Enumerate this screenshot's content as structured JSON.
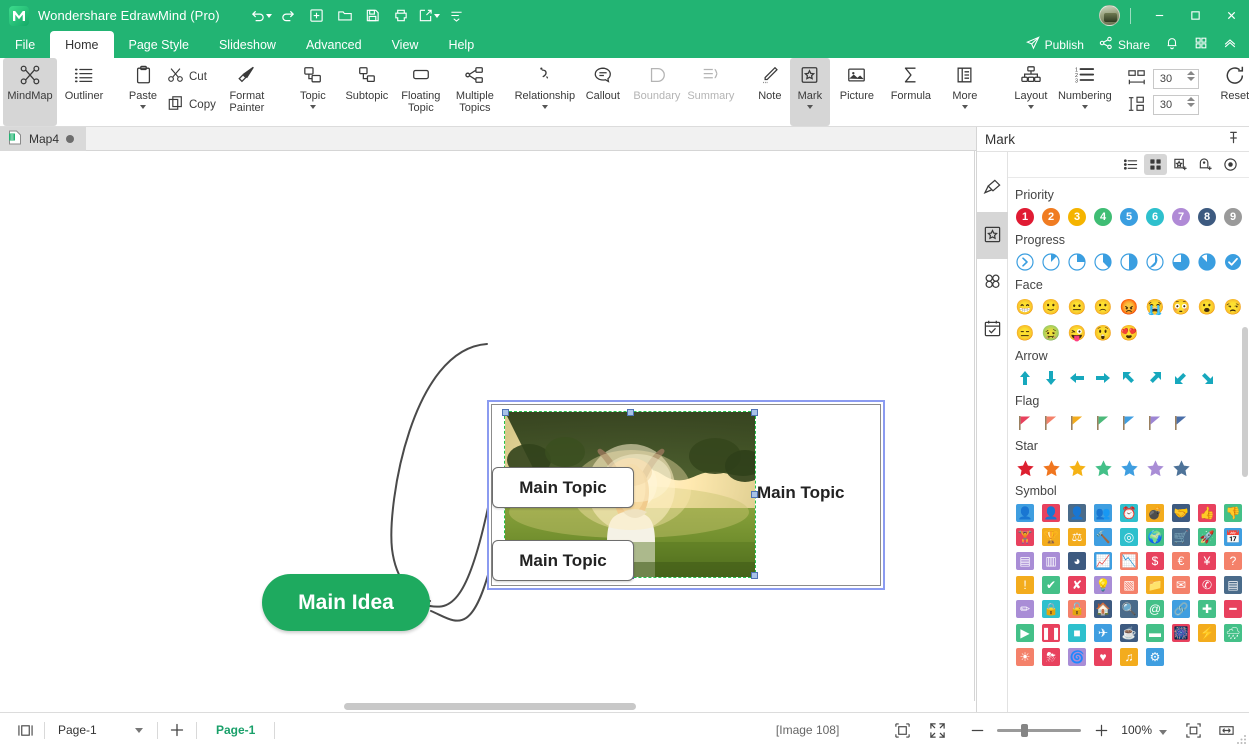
{
  "titlebar": {
    "app_title": "Wondershare EdrawMind (Pro)",
    "quick_access": [
      {
        "name": "undo-button",
        "icon": "undo-icon",
        "has_dropdown": true
      },
      {
        "name": "redo-button",
        "icon": "redo-icon",
        "has_dropdown": false
      },
      {
        "name": "new-button",
        "icon": "plus-box-icon",
        "has_dropdown": false
      },
      {
        "name": "open-button",
        "icon": "folder-icon",
        "has_dropdown": false
      },
      {
        "name": "save-button",
        "icon": "floppy-icon",
        "has_dropdown": false
      },
      {
        "name": "print-button",
        "icon": "printer-icon",
        "has_dropdown": false
      },
      {
        "name": "export-button",
        "icon": "export-icon",
        "has_dropdown": true
      },
      {
        "name": "customize-qat-button",
        "icon": "overflow-icon",
        "has_dropdown": false
      }
    ],
    "window_controls": [
      "minimize",
      "maximize",
      "close"
    ]
  },
  "menubar": {
    "tabs": [
      {
        "label": "File",
        "active": false
      },
      {
        "label": "Home",
        "active": true
      },
      {
        "label": "Page Style",
        "active": false
      },
      {
        "label": "Slideshow",
        "active": false
      },
      {
        "label": "Advanced",
        "active": false
      },
      {
        "label": "View",
        "active": false
      },
      {
        "label": "Help",
        "active": false
      }
    ],
    "right_actions": [
      {
        "label": "Publish",
        "icon": "send-icon"
      },
      {
        "label": "Share",
        "icon": "share-nodes-icon"
      },
      {
        "label": "",
        "icon": "bell-icon"
      },
      {
        "label": "",
        "icon": "apps-grid-icon"
      },
      {
        "label": "",
        "icon": "collapse-ribbon-icon"
      }
    ]
  },
  "ribbon": {
    "groups": [
      {
        "items": [
          {
            "label": "MindMap",
            "icon": "mindmap-icon",
            "selected": true,
            "disabled": false,
            "dropdown": false
          },
          {
            "label": "Outliner",
            "icon": "outliner-icon",
            "selected": false,
            "disabled": false,
            "dropdown": false
          }
        ]
      },
      {
        "items": [
          {
            "label": "Paste",
            "icon": "paste-icon",
            "selected": false,
            "disabled": false,
            "dropdown": true
          },
          {
            "label": "Cut",
            "icon": "scissors-icon",
            "selected": false,
            "disabled": false,
            "dropdown": false
          },
          {
            "label": "Copy",
            "icon": "copy-icon",
            "selected": false,
            "disabled": false,
            "dropdown": false
          },
          {
            "label": "Format Painter",
            "icon": "format-painter-icon",
            "selected": false,
            "disabled": false,
            "dropdown": false
          }
        ]
      },
      {
        "items": [
          {
            "label": "Topic",
            "icon": "topic-icon",
            "selected": false,
            "disabled": false,
            "dropdown": true
          },
          {
            "label": "Subtopic",
            "icon": "subtopic-icon",
            "selected": false,
            "disabled": false,
            "dropdown": false
          },
          {
            "label": "Floating Topic",
            "icon": "floating-topic-icon",
            "selected": false,
            "disabled": false,
            "dropdown": false
          },
          {
            "label": "Multiple Topics",
            "icon": "multiple-topics-icon",
            "selected": false,
            "disabled": false,
            "dropdown": false
          }
        ]
      },
      {
        "items": [
          {
            "label": "Relationship",
            "icon": "relationship-icon",
            "selected": false,
            "disabled": false,
            "dropdown": true
          },
          {
            "label": "Callout",
            "icon": "callout-icon",
            "selected": false,
            "disabled": false,
            "dropdown": false
          },
          {
            "label": "Boundary",
            "icon": "boundary-icon",
            "selected": false,
            "disabled": true,
            "dropdown": false
          },
          {
            "label": "Summary",
            "icon": "summary-icon",
            "selected": false,
            "disabled": true,
            "dropdown": false
          }
        ]
      },
      {
        "items": [
          {
            "label": "Note",
            "icon": "note-icon",
            "selected": false,
            "disabled": false,
            "dropdown": false
          },
          {
            "label": "Mark",
            "icon": "mark-icon",
            "selected": true,
            "disabled": false,
            "dropdown": true
          },
          {
            "label": "Picture",
            "icon": "picture-icon",
            "selected": false,
            "disabled": false,
            "dropdown": false
          },
          {
            "label": "Formula",
            "icon": "formula-icon",
            "selected": false,
            "disabled": false,
            "dropdown": false
          },
          {
            "label": "More",
            "icon": "more-icon",
            "selected": false,
            "disabled": false,
            "dropdown": true
          }
        ]
      },
      {
        "items": [
          {
            "label": "Layout",
            "icon": "layout-icon",
            "selected": false,
            "disabled": false,
            "dropdown": true
          },
          {
            "label": "Numbering",
            "icon": "numbering-icon",
            "selected": false,
            "disabled": false,
            "dropdown": true
          }
        ]
      },
      {
        "items": [
          {
            "label": "Reset",
            "icon": "reset-icon",
            "selected": false,
            "disabled": false,
            "dropdown": false
          }
        ]
      }
    ],
    "spacing": {
      "horizontal_icon": "horizontal-spacing-icon",
      "horizontal_value": "30",
      "vertical_icon": "vertical-spacing-icon",
      "vertical_value": "30"
    }
  },
  "doctab": {
    "label": "Map4",
    "icon": "document-icon",
    "modified_dot": true
  },
  "canvas": {
    "central_topic": "Main Idea",
    "topics": [
      {
        "label": "Main Topic",
        "selected": true,
        "has_image": true
      },
      {
        "label": "Main Topic",
        "selected": false,
        "has_image": false
      },
      {
        "label": "Main Topic",
        "selected": false,
        "has_image": false
      }
    ],
    "image_alt": "woman raising arms in sunlit field"
  },
  "panel": {
    "title": "Mark",
    "pin_icon": "pin-icon",
    "side_tabs": [
      {
        "name": "style-tab",
        "icon": "brush-icon",
        "selected": false
      },
      {
        "name": "mark-tab",
        "icon": "mark-badge-icon",
        "selected": true
      },
      {
        "name": "clipart-tab",
        "icon": "clover-icon",
        "selected": false
      },
      {
        "name": "task-tab",
        "icon": "task-calendar-icon",
        "selected": false
      }
    ],
    "tools": [
      {
        "name": "list-view-button",
        "icon": "list-view-icon",
        "selected": false
      },
      {
        "name": "grid-view-button",
        "icon": "grid-view-icon",
        "selected": true
      },
      {
        "name": "add-mark-button",
        "icon": "add-mark-icon",
        "selected": false
      },
      {
        "name": "add-custom-mark-button",
        "icon": "add-custom-mark-icon",
        "selected": false
      },
      {
        "name": "preview-button",
        "icon": "eye-icon",
        "selected": false
      }
    ],
    "sections": [
      {
        "title": "Priority",
        "type": "priority",
        "items": [
          {
            "label": "1",
            "color": "#e01b33"
          },
          {
            "label": "2",
            "color": "#f07c22"
          },
          {
            "label": "3",
            "color": "#f5b400"
          },
          {
            "label": "4",
            "color": "#3fbd74"
          },
          {
            "label": "5",
            "color": "#3a9ee0"
          },
          {
            "label": "6",
            "color": "#2ec0cd"
          },
          {
            "label": "7",
            "color": "#b08ad6"
          },
          {
            "label": "8",
            "color": "#3d5a80"
          },
          {
            "label": "9",
            "color": "#9a9a9a"
          }
        ]
      },
      {
        "title": "Progress",
        "type": "progress",
        "color": "#3a9ee0",
        "items": [
          0,
          12.5,
          25,
          37.5,
          50,
          62.5,
          75,
          87.5,
          100
        ]
      },
      {
        "title": "Face",
        "type": "face",
        "items": [
          "😁",
          "🙂",
          "😐",
          "🙁",
          "😡",
          "😭",
          "😳",
          "😮",
          "😒",
          "😑",
          "🤢",
          "😜",
          "😲",
          "😍"
        ]
      },
      {
        "title": "Arrow",
        "type": "arrow",
        "color": "#17a8bd",
        "items": [
          "up",
          "down",
          "left",
          "right",
          "up-left",
          "up-right",
          "down-left",
          "down-right"
        ]
      },
      {
        "title": "Flag",
        "type": "flag",
        "items": [
          "#e8415e",
          "#f4816a",
          "#f3ac1d",
          "#4cb97a",
          "#3f9ee0",
          "#9d86d4",
          "#4a6ea8"
        ]
      },
      {
        "title": "Star",
        "type": "star",
        "items": [
          "#dd2030",
          "#f0761f",
          "#f5b215",
          "#44c088",
          "#3f9ee0",
          "#a98dd6",
          "#4e7399"
        ]
      },
      {
        "title": "Symbol",
        "type": "symbol",
        "rows": [
          [
            {
              "name": "user-icon",
              "bg": "#3f9ee0",
              "glyph": "👤"
            },
            {
              "name": "user-alt-icon",
              "bg": "#e8415e",
              "glyph": "👤"
            },
            {
              "name": "user-dark-icon",
              "bg": "#4a6b8a",
              "glyph": "👤"
            },
            {
              "name": "users-icon",
              "bg": "#3f9ee0",
              "glyph": "👥"
            },
            {
              "name": "alarm-clock-icon",
              "bg": "#2ec0cd",
              "glyph": "⏰"
            },
            {
              "name": "bomb-icon",
              "bg": "#f3ac1d",
              "glyph": "💣"
            },
            {
              "name": "handshake-icon",
              "bg": "#3d5a80",
              "glyph": "🤝"
            },
            {
              "name": "thumbs-up-icon",
              "bg": "#e8415e",
              "glyph": "👍"
            },
            {
              "name": "thumbs-down-icon",
              "bg": "#44c088",
              "glyph": "👎"
            }
          ],
          [
            {
              "name": "weight-icon",
              "bg": "#e8415e",
              "glyph": "🏋"
            },
            {
              "name": "trophy-icon",
              "bg": "#f3ac1d",
              "glyph": "🏆"
            },
            {
              "name": "scales-icon",
              "bg": "#f3ac1d",
              "glyph": "⚖"
            },
            {
              "name": "gavel-icon",
              "bg": "#3f9ee0",
              "glyph": "🔨"
            },
            {
              "name": "target-icon",
              "bg": "#2ec0cd",
              "glyph": "◎"
            },
            {
              "name": "globe-icon",
              "bg": "#44c088",
              "glyph": "🌍"
            },
            {
              "name": "cart-icon",
              "bg": "#4a6b8a",
              "glyph": "🛒"
            },
            {
              "name": "rocket-icon",
              "bg": "#44c088",
              "glyph": "🚀"
            },
            {
              "name": "calendar-icon",
              "bg": "#3f9ee0",
              "glyph": "📅"
            }
          ],
          [
            {
              "name": "table-icon",
              "bg": "#a98dd6",
              "glyph": "▤"
            },
            {
              "name": "bar-chart-icon",
              "bg": "#a98dd6",
              "glyph": "▥"
            },
            {
              "name": "pie-chart-icon",
              "bg": "#3d5a80",
              "glyph": "◕"
            },
            {
              "name": "line-chart-icon",
              "bg": "#3f9ee0",
              "glyph": "📈"
            },
            {
              "name": "area-chart-icon",
              "bg": "#f4816a",
              "glyph": "📉"
            },
            {
              "name": "dollar-icon",
              "bg": "#e8415e",
              "glyph": "$"
            },
            {
              "name": "euro-icon",
              "bg": "#f4816a",
              "glyph": "€"
            },
            {
              "name": "yen-icon",
              "bg": "#e8415e",
              "glyph": "¥"
            },
            {
              "name": "question-icon",
              "bg": "#f4816a",
              "glyph": "?"
            }
          ],
          [
            {
              "name": "exclamation-icon",
              "bg": "#f3ac1d",
              "glyph": "!"
            },
            {
              "name": "check-icon",
              "bg": "#44c088",
              "glyph": "✔"
            },
            {
              "name": "cross-icon",
              "bg": "#e8415e",
              "glyph": "✘"
            },
            {
              "name": "lightbulb-icon",
              "bg": "#a98dd6",
              "glyph": "💡"
            },
            {
              "name": "layers-icon",
              "bg": "#f4816a",
              "glyph": "▧"
            },
            {
              "name": "folder-icon",
              "bg": "#f3ac1d",
              "glyph": "📁"
            },
            {
              "name": "mail-icon",
              "bg": "#f4816a",
              "glyph": "✉"
            },
            {
              "name": "phone-icon",
              "bg": "#e8415e",
              "glyph": "✆"
            },
            {
              "name": "document-icon",
              "bg": "#4a6b8a",
              "glyph": "▤"
            }
          ],
          [
            {
              "name": "pencil-icon",
              "bg": "#a98dd6",
              "glyph": "✏"
            },
            {
              "name": "lock-icon",
              "bg": "#2ec0cd",
              "glyph": "🔒"
            },
            {
              "name": "unlock-icon",
              "bg": "#f4816a",
              "glyph": "🔓"
            },
            {
              "name": "home-icon",
              "bg": "#3d5a80",
              "glyph": "🏠"
            },
            {
              "name": "search-icon",
              "bg": "#4a6b8a",
              "glyph": "🔍"
            },
            {
              "name": "at-icon",
              "bg": "#44c088",
              "glyph": "@"
            },
            {
              "name": "link-icon",
              "bg": "#3f9ee0",
              "glyph": "🔗"
            },
            {
              "name": "plus-icon",
              "bg": "#44c088",
              "glyph": "✚"
            },
            {
              "name": "minus-icon",
              "bg": "#e8415e",
              "glyph": "━"
            }
          ],
          [
            {
              "name": "play-icon",
              "bg": "#44c088",
              "glyph": "▶"
            },
            {
              "name": "pause-icon",
              "bg": "#e8415e",
              "glyph": "❚❚"
            },
            {
              "name": "stop-icon",
              "bg": "#2ec0cd",
              "glyph": "■"
            },
            {
              "name": "airplane-icon",
              "bg": "#3f9ee0",
              "glyph": "✈"
            },
            {
              "name": "coffee-icon",
              "bg": "#3d5a80",
              "glyph": "☕"
            },
            {
              "name": "battery-icon",
              "bg": "#44c088",
              "glyph": "▬"
            },
            {
              "name": "fireworks-icon",
              "bg": "#e8415e",
              "glyph": "🎆"
            },
            {
              "name": "lightning-icon",
              "bg": "#f3ac1d",
              "glyph": "⚡"
            },
            {
              "name": "rain-cloud-icon",
              "bg": "#44c088",
              "glyph": "🌧"
            }
          ],
          [
            {
              "name": "sun-icon",
              "bg": "#f4816a",
              "glyph": "☀"
            },
            {
              "name": "storm-cloud-icon",
              "bg": "#e8415e",
              "glyph": "⛈"
            },
            {
              "name": "tornado-icon",
              "bg": "#a98dd6",
              "glyph": "🌀"
            },
            {
              "name": "heart-icon",
              "bg": "#e8415e",
              "glyph": "♥"
            },
            {
              "name": "music-icon",
              "bg": "#f3ac1d",
              "glyph": "♫"
            },
            {
              "name": "gear-icon",
              "bg": "#3f9ee0",
              "glyph": "⚙"
            }
          ]
        ]
      }
    ]
  },
  "statusbar": {
    "view_toggle_icon": "page-view-icon",
    "page_select_value": "Page-1",
    "add_page_icon": "plus-icon",
    "page_tab_label": "Page-1",
    "selection_info": "[Image 108]",
    "fit_page_icon": "fit-page-icon",
    "full_screen_icon": "fullscreen-icon",
    "zoom_out_icon": "minus-icon",
    "zoom_in_icon": "plus-icon",
    "zoom_level": "100%",
    "zoom_slider_percent": 30,
    "fit_selection_icon": "fit-selection-icon",
    "fit_width_icon": "fit-width-icon"
  },
  "colors": {
    "brand_green": "#22b473",
    "central_node_green": "#1eaa5f",
    "selection_blue": "#8b9bf0",
    "image_outline_green": "#22c24a"
  }
}
